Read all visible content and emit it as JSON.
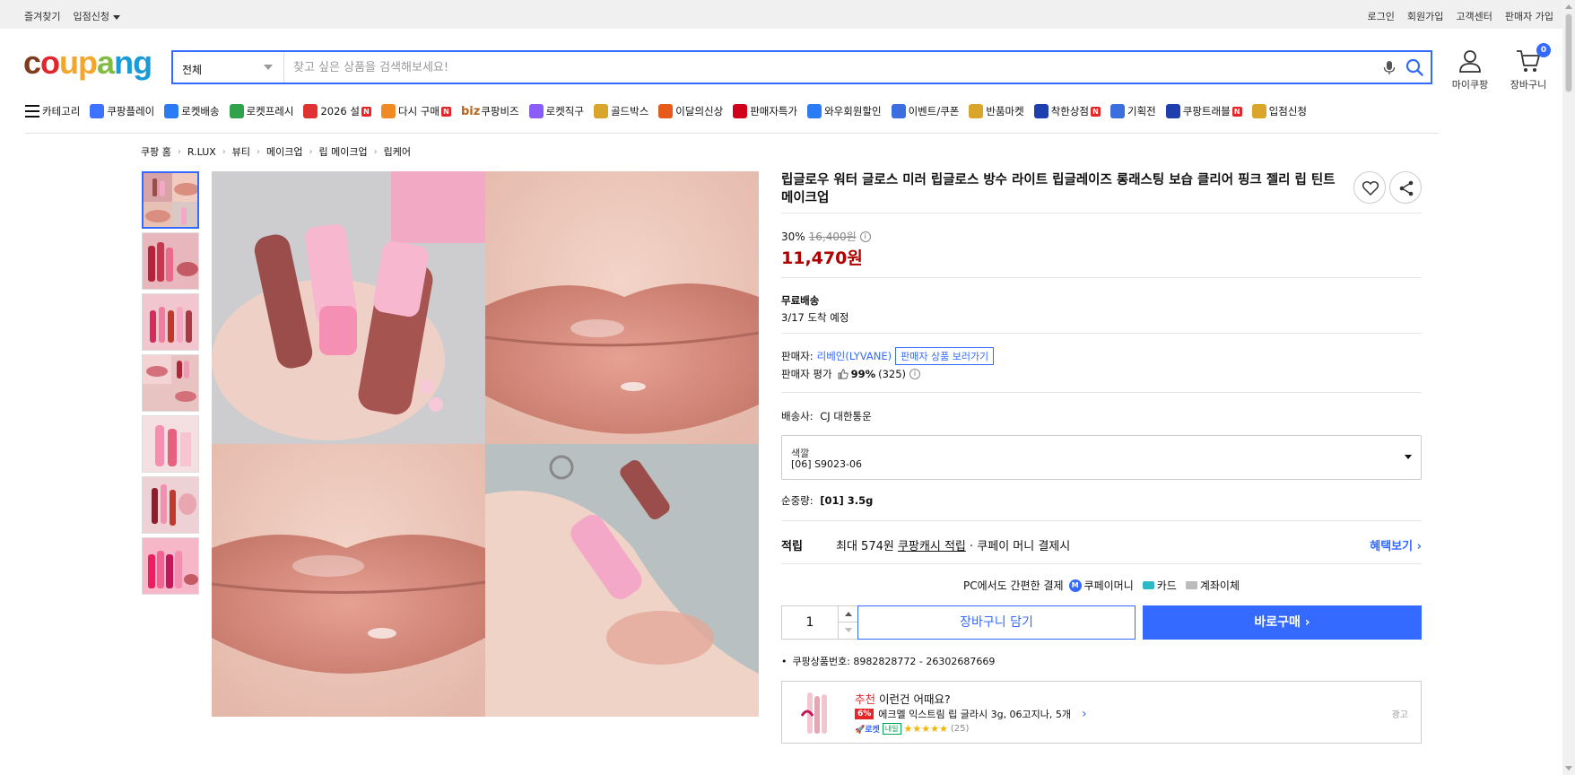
{
  "topbar": {
    "left": [
      "즐겨찾기",
      "입점신청"
    ],
    "right": [
      "로그인",
      "회원가입",
      "고객센터",
      "판매자 가입"
    ]
  },
  "logo": {
    "text": "coupang",
    "colors": [
      "#7f3b1e",
      "#e3252b",
      "#f3a62b",
      "#80bc41",
      "#1a9bd7"
    ]
  },
  "search": {
    "category": "전체",
    "placeholder": "찾고 싶은 상품을 검색해보세요!"
  },
  "header_buttons": {
    "mycoupang": "마이쿠팡",
    "cart": "장바구니",
    "cart_count": "0"
  },
  "nav": [
    {
      "label": "카테고리",
      "icon": "menu-icon"
    },
    {
      "label": "쿠팡플레이",
      "icon": "play-icon",
      "color": "#3d73ff"
    },
    {
      "label": "로켓배송",
      "icon": "rocket-icon",
      "color": "#2a7bf4"
    },
    {
      "label": "로켓프레시",
      "icon": "rocket-fresh-icon",
      "color": "#31a24c"
    },
    {
      "label": "2026 설",
      "icon": "gift-icon",
      "color": "#d33",
      "badge": "N"
    },
    {
      "label": "다시 구매",
      "icon": "repurchase-icon",
      "color": "#f08a24",
      "badge": "N"
    },
    {
      "label": "쿠팡비즈",
      "prefix": "biz",
      "icon": "biz-icon",
      "color": "#b5651d"
    },
    {
      "label": "로켓직구",
      "icon": "global-icon",
      "color": "#8b5cf6"
    },
    {
      "label": "골드박스",
      "icon": "goldbox-icon",
      "color": "#d9a62b"
    },
    {
      "label": "이달의신상",
      "icon": "new-icon",
      "color": "#e85a1c"
    },
    {
      "label": "판매자특가",
      "icon": "percent-icon",
      "color": "#d0021b"
    },
    {
      "label": "와우회원할인",
      "icon": "wow-icon",
      "color": "#2a7bf4"
    },
    {
      "label": "이벤트/쿠폰",
      "icon": "coupon-icon",
      "color": "#3b6fe0"
    },
    {
      "label": "반품마켓",
      "icon": "market-icon",
      "color": "#d9a62b"
    },
    {
      "label": "착한상점",
      "icon": "store-icon",
      "color": "#1e40af",
      "badge": "N"
    },
    {
      "label": "기획전",
      "icon": "tag-icon",
      "color": "#3b6fe0"
    },
    {
      "label": "쿠팡트래블",
      "icon": "travel-icon",
      "color": "#1e40af",
      "badge": "N"
    },
    {
      "label": "입점신청",
      "icon": "shop-icon",
      "color": "#d9a62b"
    }
  ],
  "breadcrumb": [
    "쿠팡 홈",
    "R.LUX",
    "뷰티",
    "메이크업",
    "립 메이크업",
    "립케어"
  ],
  "product": {
    "title": "립글로우 워터 글로스 미러 립글로스 방수 라이트 립글레이즈 롱래스팅 보습 클리어 핑크 젤리 립 틴트 메이크업",
    "discount": "30%",
    "original_price": "16,400원",
    "sale_price": "11,470원",
    "shipping_label": "무료배송",
    "shipping_eta": "3/17 도착 예정",
    "seller_label": "판매자:",
    "seller_name": "리베인(LYVANE)",
    "seller_link": "판매자 상품 보러가기",
    "seller_rating_label": "판매자 평가",
    "seller_rating": "99%",
    "seller_rating_count": "(325)",
    "courier_label": "배송사:",
    "courier": "CJ 대한통운",
    "option_label": "색깔",
    "option_value": "[06] S9023-06",
    "weight_label": "순중량:",
    "weight_value": "[01] 3.5g",
    "reward_title": "적립",
    "reward_prefix": "최대 574원",
    "reward_link": "쿠팡캐시 적립",
    "reward_suffix": "· 쿠페이 머니 결제시",
    "reward_more": "혜택보기 ›",
    "pay_intro": "PC에서도 간편한 결제",
    "pay_money": "쿠페이머니",
    "pay_card": "카드",
    "pay_bank": "계좌이체",
    "quantity": "1",
    "add_cart": "장바구니 담기",
    "buy_now": "바로구매 ›",
    "product_id": "쿠팡상품번호: 8982828772 - 26302687669"
  },
  "ad": {
    "recommend": "추천",
    "title_rest": " 이런건 어때요?",
    "discount": "6%",
    "name": "에크멜 익스트림 립 글라시 3g, 06고지나, 5개",
    "rocket": "로켓",
    "tomorrow": "내일",
    "stars": "★★★★★",
    "reviews": "(25)",
    "tag": "광고"
  }
}
